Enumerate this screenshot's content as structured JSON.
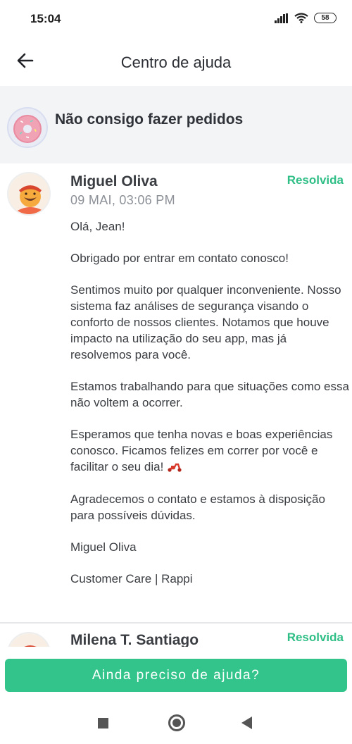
{
  "status_bar": {
    "time": "15:04",
    "battery": "58",
    "icons": [
      "signal-icon",
      "wifi-icon",
      "battery-icon"
    ]
  },
  "header": {
    "title": "Centro de ajuda",
    "back_icon": "back-arrow-icon"
  },
  "topic": {
    "title": "Não consigo fazer pedidos",
    "avatar_icon": "donut-avatar-icon"
  },
  "messages": [
    {
      "author": "Miguel Oliva",
      "date": "09 MAI, 03:06 PM",
      "status": "Resolvida",
      "paragraphs": [
        "Olá, Jean!",
        "Obrigado por entrar em contato conosco!",
        "Sentimos muito por qualquer inconveniente. Nosso sistema faz análises de segurança visando o conforto de nossos clientes. Notamos que houve impacto na utilização do seu app, mas já resolvemos para você.",
        "Estamos trabalhando para que situações como essa não voltem a ocorrer.",
        "Esperamos que tenha novas e boas experiências conosco. Ficamos felizes em correr por você e facilitar o seu dia!",
        "Agradecemos o contato e estamos à disposição para possíveis dúvidas.",
        "Miguel Oliva",
        "Customer Care | Rappi"
      ]
    },
    {
      "author": "Milena T. Santiago",
      "status": "Resolvida"
    }
  ],
  "footer": {
    "button_label": "Ainda preciso de ajuda?"
  },
  "colors": {
    "accent": "#33c48b",
    "status_text": "#2fbf86",
    "topic_bg": "#f3f4f6"
  }
}
